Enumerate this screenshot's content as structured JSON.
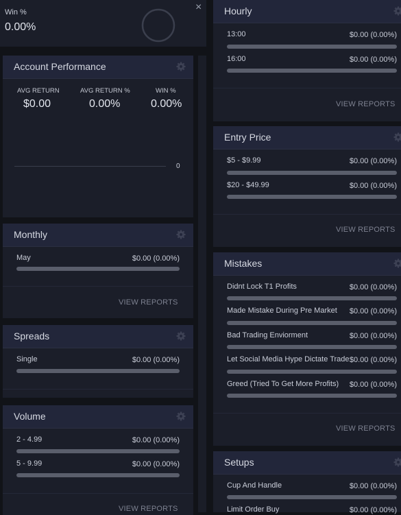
{
  "winrate": {
    "label": "Win %",
    "value": "0.00%",
    "close": "×"
  },
  "account_performance": {
    "title": "Account Performance",
    "kpis": [
      {
        "label": "AVG RETURN",
        "value": "$0.00"
      },
      {
        "label": "AVG RETURN %",
        "value": "0.00%"
      },
      {
        "label": "WIN %",
        "value": "0.00%"
      }
    ],
    "chart_axis_value": "0"
  },
  "monthly": {
    "title": "Monthly",
    "rows": [
      {
        "label": "May",
        "value": "$0.00 (0.00%)"
      }
    ],
    "view_reports": "VIEW REPORTS"
  },
  "spreads": {
    "title": "Spreads",
    "rows": [
      {
        "label": "Single",
        "value": "$0.00 (0.00%)"
      }
    ]
  },
  "volume": {
    "title": "Volume",
    "rows": [
      {
        "label": "2 - 4.99",
        "value": "$0.00 (0.00%)"
      },
      {
        "label": "5 - 9.99",
        "value": "$0.00 (0.00%)"
      }
    ],
    "view_reports": "VIEW REPORTS"
  },
  "hourly": {
    "title": "Hourly",
    "rows": [
      {
        "label": "13:00",
        "value": "$0.00 (0.00%)"
      },
      {
        "label": "16:00",
        "value": "$0.00 (0.00%)"
      }
    ],
    "view_reports": "VIEW REPORTS"
  },
  "entry_price": {
    "title": "Entry Price",
    "rows": [
      {
        "label": "$5 - $9.99",
        "value": "$0.00 (0.00%)"
      },
      {
        "label": "$20 - $49.99",
        "value": "$0.00 (0.00%)"
      }
    ],
    "view_reports": "VIEW REPORTS"
  },
  "mistakes": {
    "title": "Mistakes",
    "rows": [
      {
        "label": "Didnt Lock T1 Profits",
        "value": "$0.00 (0.00%)"
      },
      {
        "label": "Made Mistake During Pre Market",
        "value": "$0.00 (0.00%)"
      },
      {
        "label": "Bad Trading Enviorment",
        "value": "$0.00 (0.00%)"
      },
      {
        "label": "Let Social Media Hype Dictate Trade",
        "value": "$0.00 (0.00%)"
      },
      {
        "label": "Greed (Tried To Get More Profits)",
        "value": "$0.00 (0.00%)"
      }
    ],
    "view_reports": "VIEW REPORTS"
  },
  "setups": {
    "title": "Setups",
    "rows": [
      {
        "label": "Cup And Handle",
        "value": "$0.00 (0.00%)"
      },
      {
        "label": "Limit Order Buy",
        "value": "$0.00 (0.00%)"
      }
    ]
  },
  "icons": {
    "settings": "gear-icon",
    "close": "close-icon",
    "progress": "progress-ring-icon"
  },
  "colors": {
    "card": "#1b1e29",
    "header": "#22263a",
    "bar": "#5a5e6b",
    "background": "#111318"
  }
}
